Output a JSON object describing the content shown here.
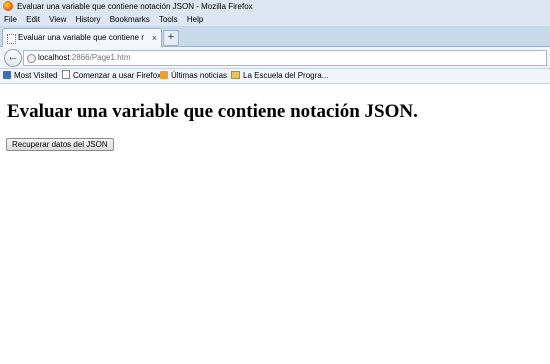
{
  "window": {
    "title": "Evaluar una variable que contiene notación JSON - Mozilla Firefox"
  },
  "menu": [
    "File",
    "Edit",
    "View",
    "History",
    "Bookmarks",
    "Tools",
    "Help"
  ],
  "tab": {
    "label": "Evaluar una variable que contiene notaci...",
    "close": "×"
  },
  "new_tab": "+",
  "nav": {
    "back": "←",
    "url_host": "localhost",
    "url_path": ":2866/Page1.htm"
  },
  "bookmarks": [
    "Most Visited",
    "Comenzar a usar Firefox",
    "Últimas noticias",
    "La Escuela del Progra..."
  ],
  "page": {
    "heading": "Evaluar una variable que contiene notación JSON.",
    "button": "Recuperar datos del JSON"
  }
}
